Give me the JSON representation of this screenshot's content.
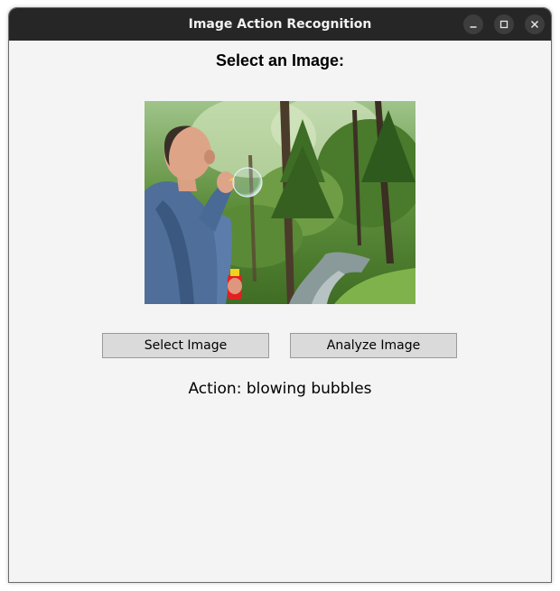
{
  "window": {
    "title": "Image Action Recognition",
    "controls": {
      "minimize_icon": "minimize-icon",
      "maximize_icon": "maximize-icon",
      "close_icon": "close-icon"
    }
  },
  "main": {
    "heading": "Select an Image:",
    "buttons": {
      "select_label": "Select Image",
      "analyze_label": "Analyze Image"
    },
    "result_text": "Action: blowing bubbles"
  },
  "colors": {
    "titlebar": "#262626",
    "window_bg": "#f4f4f4",
    "button_bg": "#dadada"
  }
}
